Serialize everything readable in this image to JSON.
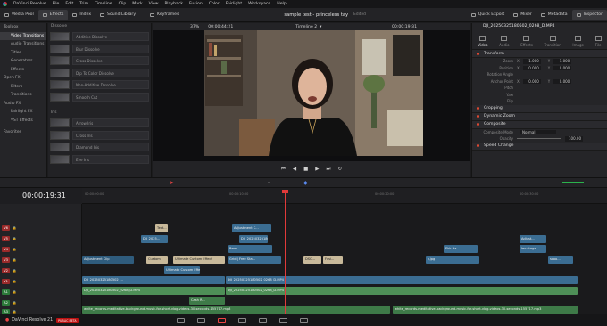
{
  "app": {
    "title": "DaVinci Resolve",
    "menu": [
      "DaVinci Resolve",
      "File",
      "Edit",
      "Trim",
      "Timeline",
      "Clip",
      "Mark",
      "View",
      "Playback",
      "Fusion",
      "Color",
      "Fairlight",
      "Workspace",
      "Help"
    ]
  },
  "toolbar": {
    "buttons": [
      "Media Pool",
      "Effects",
      "Index",
      "Sound Library",
      "Keyframes"
    ],
    "project": "sample test - princeless tay",
    "status": "Edited",
    "right": [
      "Quick Export",
      "Mixer",
      "Metadata",
      "Inspector"
    ]
  },
  "effects_tree": [
    "Toolbox",
    "Video Transitions",
    "Audio Transitions",
    "Titles",
    "Generators",
    "Effects",
    "Open FX",
    "Filters",
    "Transitions",
    "Audio FX",
    "Fairlight FX",
    "VST Effects",
    "Favorites"
  ],
  "effects_panel": {
    "section1": "Dissolve",
    "items1": [
      "Additive Dissolve",
      "Blur Dissolve",
      "Cross Dissolve",
      "Dip To Color Dissolve",
      "Non-Additive Dissolve",
      "Smooth Cut"
    ],
    "section2": "Iris",
    "items2": [
      "Arrow Iris",
      "Cross Iris",
      "Diamond Iris",
      "Eye Iris"
    ]
  },
  "viewer": {
    "zoom": "37%",
    "timecode_left": "00:00:44:21",
    "timeline_name": "Timeline 2",
    "timecode_right": "00:00:19:31"
  },
  "inspector": {
    "clip": "DJI_20250325180502_0268_D.MP4",
    "tabs": [
      "Video",
      "Audio",
      "Effects",
      "Transition",
      "Image",
      "File"
    ],
    "transform": "Transform",
    "zoom": {
      "label": "Zoom",
      "x": "1.000",
      "y": "1.000"
    },
    "position": {
      "label": "Position",
      "x": "0.000",
      "y": "0.000"
    },
    "rotation": "Rotation Angle",
    "anchor": {
      "label": "Anchor Point",
      "x": "0.000",
      "y": "0.000"
    },
    "pitch": "Pitch",
    "yaw": "Yaw",
    "flip": "Flip",
    "cropping": "Cropping",
    "dynamic_zoom": "Dynamic Zoom",
    "composite": "Composite",
    "composite_mode_label": "Composite Mode",
    "composite_mode": "Normal",
    "opacity_label": "Opacity",
    "opacity": "100.00",
    "speed_change": "Speed Change"
  },
  "timeline": {
    "timecode": "00:00:19:31",
    "ruler": [
      "00:00:00:00",
      "00:00:10:00",
      "00:00:20:00",
      "00:00:30:00",
      "00:00:40:00"
    ],
    "tracks": [
      "V6",
      "V5",
      "V4",
      "V3",
      "V2",
      "V1",
      "A1",
      "A2",
      "A3"
    ],
    "clips": {
      "adj1": "Adjustment Clip",
      "adj2": "Adjustment C...",
      "adj3": "Adjust...",
      "dji1": "DJI_2025...",
      "dji2": "DJI_20250325180502_...",
      "dji3": "DJI_20250325180502_0268_D.MP4",
      "dji4": "DJI_20250325180502_0268_D.MP4",
      "dji5": "DJI_20250325180502_0...",
      "dji6": "DJI_20250325180502_0268_D.MP4",
      "ult": "Ultimate Custom Effect",
      "grid": "Grid | Free Sta...",
      "dsc": "DSC...",
      "cust": "Custom",
      "yjpg": "y.jpg",
      "ekk": "Ekk Ha...",
      "leo": "leo stage",
      "scoo": "scoo...",
      "rem": "Rem...",
      "text": "Text...",
      "fuse": "Fusi...",
      "cash": "Cash R...",
      "a2": "white_records-meditative-background-music-for-short-vlog-videos-30-seconds-155717.mp3",
      "a3": "white_records-meditative-background-music-for-short-vlog-videos-30-seconds-155717.mp3"
    }
  },
  "bottom": {
    "brand": "DaVinci Resolve 21",
    "badge": "PUBLIC BETA"
  }
}
